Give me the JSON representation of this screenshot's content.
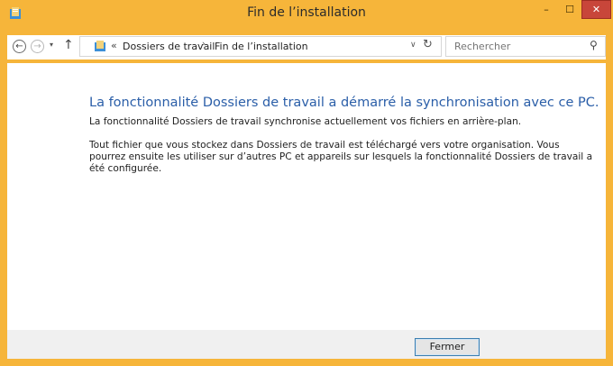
{
  "window": {
    "title": "Fin de l’installation",
    "minimize_label": "–",
    "maximize_label": "☐",
    "close_label": "✕"
  },
  "addressbar": {
    "back_glyph": "←",
    "forward_glyph": "→",
    "history_glyph": "▾",
    "up_glyph": "↑",
    "overflow_glyph": "«",
    "breadcrumb": [
      "Dossiers de travail",
      "Fin de l’installation"
    ],
    "separator_glyph": "›",
    "dropdown_glyph": "∨",
    "refresh_glyph": "↻",
    "search_placeholder": "Rechercher",
    "search_glyph": "⚲"
  },
  "main": {
    "heading": "La fonctionnalité Dossiers de travail a démarré la synchronisation avec ce PC.",
    "paragraph1": "La fonctionnalité Dossiers de travail synchronise actuellement vos fichiers en arrière-plan.",
    "paragraph2": "Tout fichier que vous stockez dans Dossiers de travail est téléchargé vers votre organisation. Vous pourrez ensuite les utiliser sur d’autres PC et appareils sur lesquels la fonctionnalité Dossiers de travail a été configurée."
  },
  "footer": {
    "close_button_label": "Fermer"
  },
  "colors": {
    "frame": "#f6b53a",
    "heading": "#2a5ea8",
    "close_button_bg": "#c8463a"
  }
}
